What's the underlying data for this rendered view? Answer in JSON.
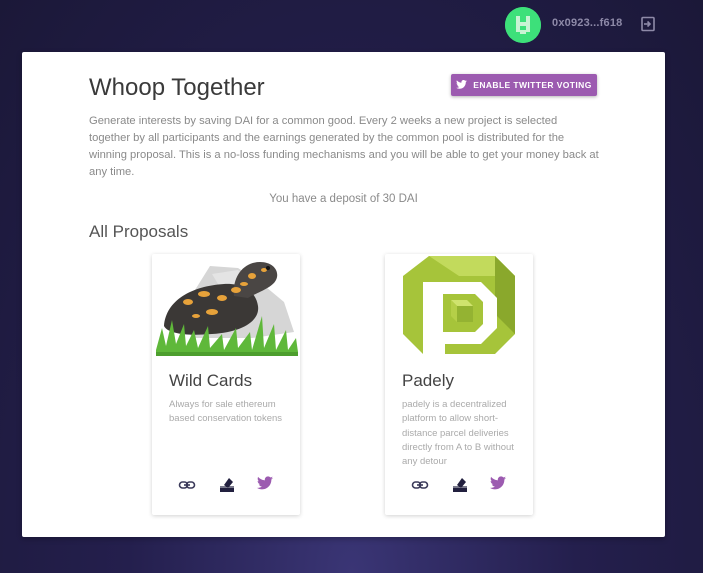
{
  "header": {
    "wallet_address": "0x0923...f618"
  },
  "main": {
    "title": "Whoop Together",
    "twitter_button_label": "ENABLE TWITTER VOTING",
    "description": "Generate interests by saving DAI for a common good. Every 2 weeks a new project is selected together by all participants and the earnings generated by the common pool is distributed for the winning proposal. This is a no-loss funding mechanisms and you will be able to get your money back at any time.",
    "deposit_text": "You have a deposit of 30 DAI",
    "section_title": "All Proposals",
    "proposals": [
      {
        "name": "Wild Cards",
        "description": "Always for sale ethereum based conservation tokens"
      },
      {
        "name": "Padely",
        "description": "padely is a decentralized platform to allow short-distance parcel deliveries directly from A to B without any detour"
      }
    ]
  },
  "colors": {
    "accent_purple": "#9c5bb0",
    "avatar_green": "#3de07a",
    "icon_dark": "#3b3a5a"
  },
  "icons": {
    "logout": "logout-icon",
    "link": "link-icon",
    "vote": "ballot-box-icon",
    "twitter": "twitter-icon"
  }
}
